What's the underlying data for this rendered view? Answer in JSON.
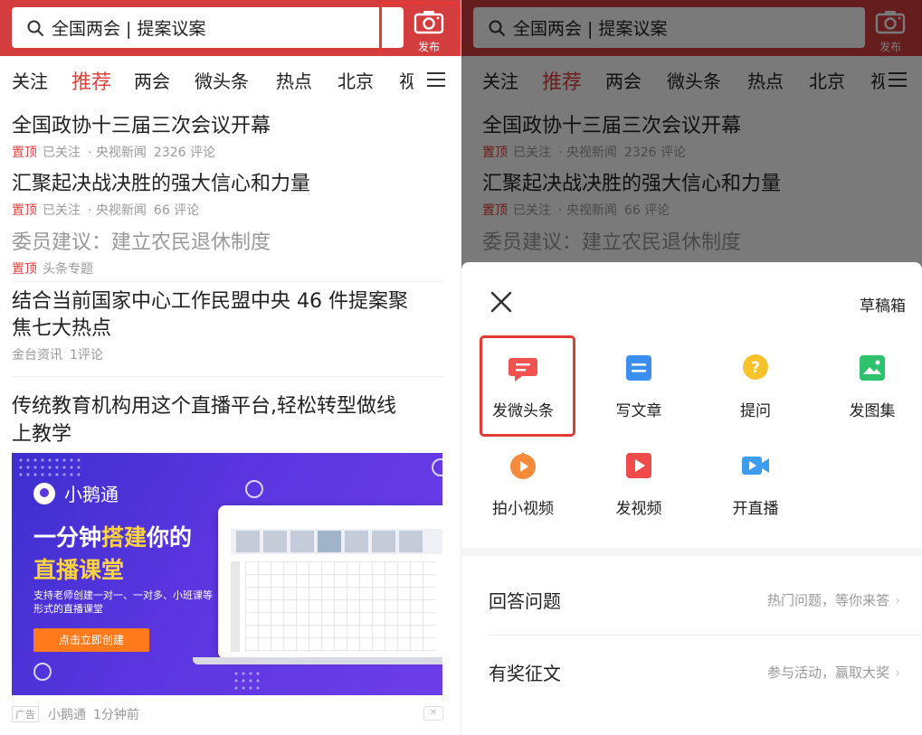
{
  "search": {
    "placeholder": "全国两会 | 提案议案"
  },
  "publish": {
    "label": "发布"
  },
  "tabs": [
    "关注",
    "推荐",
    "两会",
    "微头条",
    "热点",
    "北京",
    "视"
  ],
  "feed": [
    {
      "title": "全国政协十三届三次会议开幕",
      "pin": "置顶",
      "followed": "已关注",
      "source": "· 央视新闻",
      "comments": "2326 评论"
    },
    {
      "title": "汇聚起决战决胜的强大信心和力量",
      "pin": "置顶",
      "followed": "已关注",
      "source": "· 央视新闻",
      "comments": "66 评论"
    },
    {
      "title": "委员建议：建立农民退休制度",
      "pin": "置顶",
      "source": "头条专题"
    },
    {
      "title_line1": "结合当前国家中心工作民盟中央 46 件提案聚",
      "title_line2": "焦七大热点",
      "source": "金台资讯",
      "comments": "1评论"
    }
  ],
  "ad": {
    "title_line1": "传统教育机构用这个直播平台,轻松转型做线",
    "title_line2": "上教学",
    "brand": "小鹅通",
    "headline_a": "一分钟",
    "headline_b": "搭建",
    "headline_c": "你的",
    "headline_2": "直播课堂",
    "desc": "支持老师创建一对一、一对多、小班课等形式的直播课堂",
    "cta": "点击立即创建",
    "tag": "广告",
    "advertiser": "小鹅通",
    "time": "1分钟前"
  },
  "sheet": {
    "draft": "草稿箱",
    "items": [
      {
        "label": "发微头条",
        "icon": "weitoutiao-icon",
        "color": "#f0524f"
      },
      {
        "label": "写文章",
        "icon": "article-icon",
        "color": "#3b8ff0"
      },
      {
        "label": "提问",
        "icon": "question-icon",
        "color": "#f8c22a"
      },
      {
        "label": "发图集",
        "icon": "gallery-icon",
        "color": "#2fc26e"
      },
      {
        "label": "拍小视频",
        "icon": "small-video-icon",
        "color": "#f78a3a"
      },
      {
        "label": "发视频",
        "icon": "video-icon",
        "color": "#ef4b4b"
      },
      {
        "label": "开直播",
        "icon": "live-icon",
        "color": "#3b9cf0"
      }
    ],
    "rows": [
      {
        "title": "回答问题",
        "hint": "热门问题，等你来答"
      },
      {
        "title": "有奖征文",
        "hint": "参与活动，赢取大奖"
      }
    ]
  }
}
